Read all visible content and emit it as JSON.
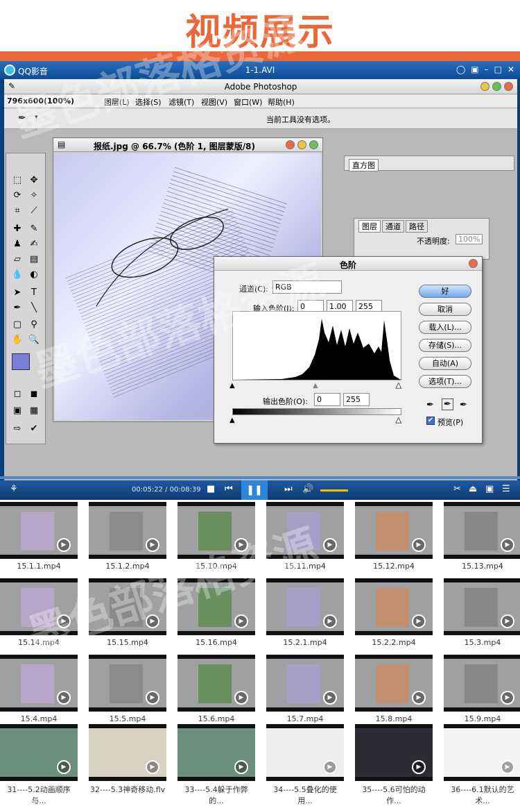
{
  "banner": {
    "title": "视频展示"
  },
  "player": {
    "app_name": "QQ影音",
    "file_name": "1-1.AVI",
    "time": "00:05:22 / 00:08:39"
  },
  "photoshop": {
    "title": "Adobe Photoshop",
    "resolution": "796x600(100%)",
    "menu": [
      "图层(L)",
      "选择(S)",
      "滤镜(T)",
      "视图(V)",
      "窗口(W)",
      "帮助(H)"
    ],
    "options_msg": "当前工具没有选项。",
    "doc_title": "报纸.jpg @ 66.7% (色阶 1, 图层蒙版/8)",
    "histogram_tab": "直方图",
    "layers_tabs": [
      "图层",
      "通道",
      "路径"
    ],
    "opacity_label": "不透明度:",
    "opacity_value": "100%",
    "levels": {
      "title": "色阶",
      "channel_label": "通道(C):",
      "channel_value": "RGB",
      "input_label": "输入色阶(I):",
      "input_values": [
        "0",
        "1.00",
        "255"
      ],
      "output_label": "输出色阶(O):",
      "output_values": [
        "0",
        "255"
      ],
      "buttons": [
        "好",
        "取消",
        "载入(L)...",
        "存储(S)...",
        "自动(A)",
        "选项(T)..."
      ],
      "preview_label": "预览(P)"
    }
  },
  "thumbnails": [
    "15.1.1.mp4",
    "15.1.2.mp4",
    "15.10.mp4",
    "15.11.mp4",
    "15.12.mp4",
    "15.13.mp4",
    "15.14.mp4",
    "15.15.mp4",
    "15.16.mp4",
    "15.2.1.mp4",
    "15.2.2.mp4",
    "15.3.mp4",
    "15.4.mp4",
    "15.5.mp4",
    "15.6.mp4",
    "15.7.mp4",
    "15.8.mp4",
    "15.9.mp4",
    "31----5.2动画顺序与...",
    "32----5.3神奇移动.flv",
    "33----5.4躲于作弊的...",
    "34----5.5叠化的使用...",
    "35----5.6可怕的动作...",
    "36----6.1默认的艺术..."
  ],
  "watermark": "墨色部落格资源"
}
